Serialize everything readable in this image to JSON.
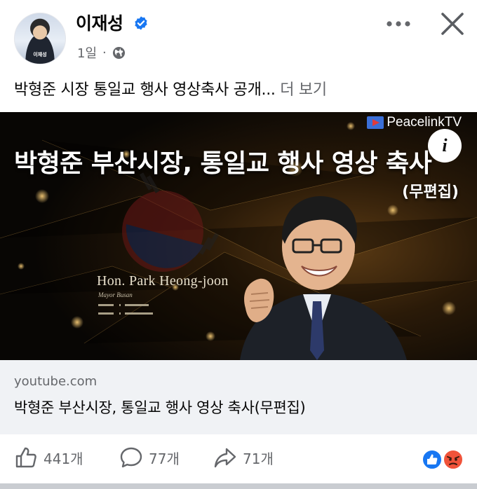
{
  "author": {
    "name": "이재성",
    "avatar_caption": "이재성",
    "verified": true
  },
  "meta": {
    "time": "1일",
    "separator": "·",
    "privacy_icon": "globe-icon"
  },
  "post": {
    "text": "박형준 시장 통일교 행사 영상축사 공개...",
    "see_more_label": "더 보기"
  },
  "video": {
    "channel_logo": "PeacelinkTV",
    "title": "박형준 부산시장, 통일교 행사 영상 축사",
    "subtitle": "(무편집)",
    "caption_name": "Hon. Park Heong-joon",
    "caption_role": "Mayor Busan",
    "info_icon": "i"
  },
  "link": {
    "domain": "youtube.com",
    "title": "박형준 부산시장, 통일교 행사 영상 축사(무편집)"
  },
  "actions": {
    "like_count": "441개",
    "comment_count": "77개",
    "share_count": "71개"
  },
  "colors": {
    "secondary_text": "#65676b",
    "link_card_bg": "#f0f2f5",
    "verified_blue": "#1877f2",
    "angry_orange": "#f0533a"
  }
}
